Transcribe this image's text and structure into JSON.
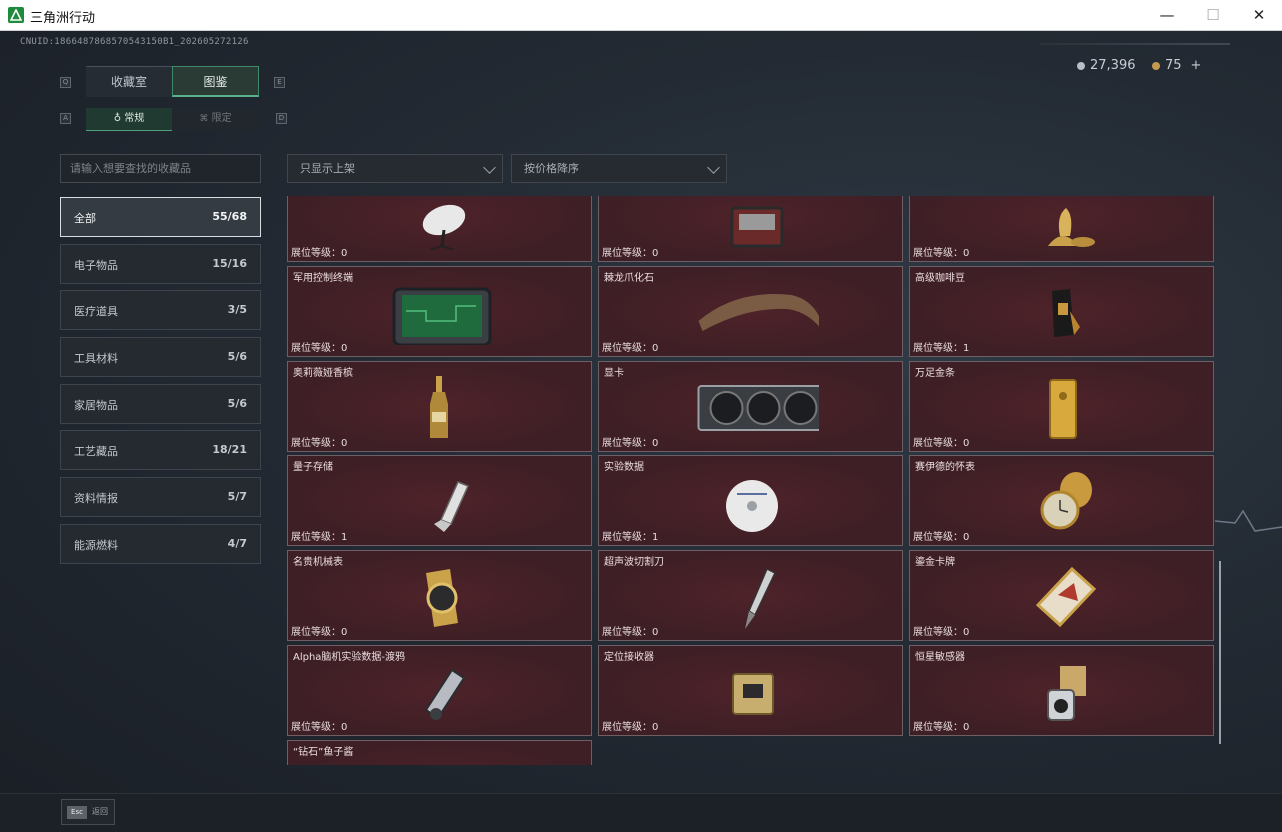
{
  "window": {
    "title": "三角洲行动",
    "min": "—",
    "max": "☐",
    "close": "✕"
  },
  "header": {
    "uid": "CNUID:1866487868570543150B1_202605272126",
    "silver": "27,396",
    "gold": "75",
    "plus": "+"
  },
  "keys": {
    "q": "Q",
    "e": "E",
    "a": "A",
    "d": "D"
  },
  "tabs": {
    "collection": "收藏室",
    "catalog": "图鉴"
  },
  "subtabs": {
    "normal": "常规",
    "limited": "限定"
  },
  "search": {
    "placeholder": "请输入想要查找的收藏品"
  },
  "filters": {
    "listed": "只显示上架",
    "sort": "按价格降序"
  },
  "categories": [
    {
      "label": "全部",
      "count": "55/68"
    },
    {
      "label": "电子物品",
      "count": "15/16"
    },
    {
      "label": "医疗道具",
      "count": "3/5"
    },
    {
      "label": "工具材料",
      "count": "5/6"
    },
    {
      "label": "家居物品",
      "count": "5/6"
    },
    {
      "label": "工艺藏品",
      "count": "18/21"
    },
    {
      "label": "资料情报",
      "count": "5/7"
    },
    {
      "label": "能源燃料",
      "count": "4/7"
    }
  ],
  "items": [
    {
      "name": "",
      "level": "展位等级：0",
      "icon": "satellite-dish-icon"
    },
    {
      "name": "",
      "level": "展位等级：0",
      "icon": "radio-device-icon"
    },
    {
      "name": "",
      "level": "展位等级：0",
      "icon": "golden-statue-icon"
    },
    {
      "name": "军用控制终端",
      "level": "展位等级：0",
      "icon": "control-terminal-icon"
    },
    {
      "name": "棘龙爪化石",
      "level": "展位等级：0",
      "icon": "claw-fossil-icon"
    },
    {
      "name": "高级咖啡豆",
      "level": "展位等级：1",
      "icon": "coffee-bag-icon"
    },
    {
      "name": "奥莉薇娅香槟",
      "level": "展位等级：0",
      "icon": "champagne-icon"
    },
    {
      "name": "显卡",
      "level": "展位等级：0",
      "icon": "graphics-card-icon"
    },
    {
      "name": "万足金条",
      "level": "展位等级：0",
      "icon": "gold-bar-icon"
    },
    {
      "name": "量子存储",
      "level": "展位等级：1",
      "icon": "usb-drive-icon"
    },
    {
      "name": "实验数据",
      "level": "展位等级：1",
      "icon": "disc-icon"
    },
    {
      "name": "赛伊德的怀表",
      "level": "展位等级：0",
      "icon": "pocket-watch-icon"
    },
    {
      "name": "名贵机械表",
      "level": "展位等级：0",
      "icon": "wristwatch-icon"
    },
    {
      "name": "超声波切割刀",
      "level": "展位等级：0",
      "icon": "ultrasonic-cutter-icon"
    },
    {
      "name": "鎏金卡牌",
      "level": "展位等级：0",
      "icon": "gilded-card-icon"
    },
    {
      "name": "Alpha脑机实验数据-渡鸦",
      "level": "展位等级：0",
      "icon": "data-capsule-icon"
    },
    {
      "name": "定位接收器",
      "level": "展位等级：0",
      "icon": "locator-receiver-icon"
    },
    {
      "name": "恒星敏感器",
      "level": "展位等级：0",
      "icon": "star-sensor-icon"
    },
    {
      "name": "“钻石”鱼子酱",
      "level": "",
      "icon": "caviar-icon"
    }
  ],
  "bottom": {
    "esc_key": "Esc",
    "esc_label": "返回"
  }
}
